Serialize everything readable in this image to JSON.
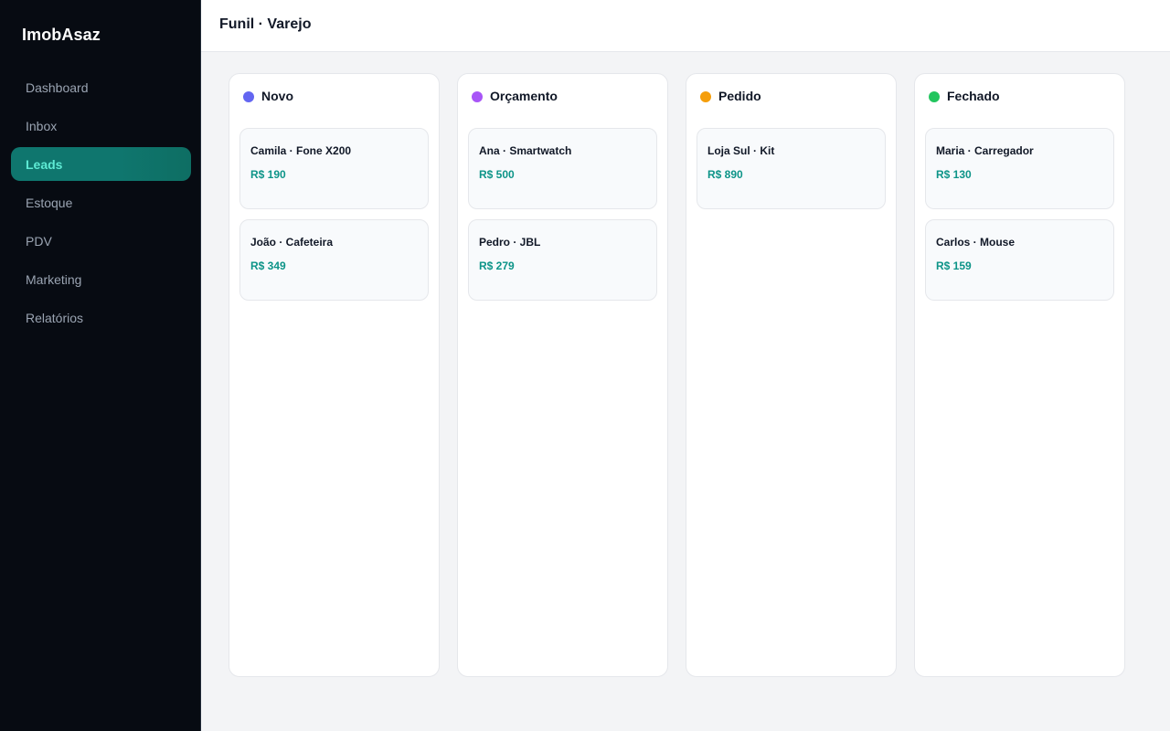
{
  "brand": "ImobAsaz",
  "nav": [
    {
      "label": "Dashboard",
      "active": false
    },
    {
      "label": "Inbox",
      "active": false
    },
    {
      "label": "Leads",
      "active": true
    },
    {
      "label": "Estoque",
      "active": false
    },
    {
      "label": "PDV",
      "active": false
    },
    {
      "label": "Marketing",
      "active": false
    },
    {
      "label": "Relatórios",
      "active": false
    }
  ],
  "page_title": "Funil · Varejo",
  "columns": [
    {
      "title": "Novo",
      "color": "#6366f1",
      "cards": [
        {
          "title": "Camila · Fone X200",
          "price": "R$ 190"
        },
        {
          "title": "João · Cafeteira",
          "price": "R$ 349"
        }
      ]
    },
    {
      "title": "Orçamento",
      "color": "#a855f7",
      "cards": [
        {
          "title": "Ana · Smartwatch",
          "price": "R$ 500"
        },
        {
          "title": "Pedro · JBL",
          "price": "R$ 279"
        }
      ]
    },
    {
      "title": "Pedido",
      "color": "#f59e0b",
      "cards": [
        {
          "title": "Loja Sul · Kit",
          "price": "R$ 890"
        }
      ]
    },
    {
      "title": "Fechado",
      "color": "#22c55e",
      "cards": [
        {
          "title": "Maria · Carregador",
          "price": "R$ 130"
        },
        {
          "title": "Carlos · Mouse",
          "price": "R$ 159"
        }
      ]
    }
  ],
  "colors": {
    "sidebar_bg": "#070b12",
    "accent": "#0f766e",
    "accent_text": "#5eead4",
    "price": "#0d9488"
  }
}
